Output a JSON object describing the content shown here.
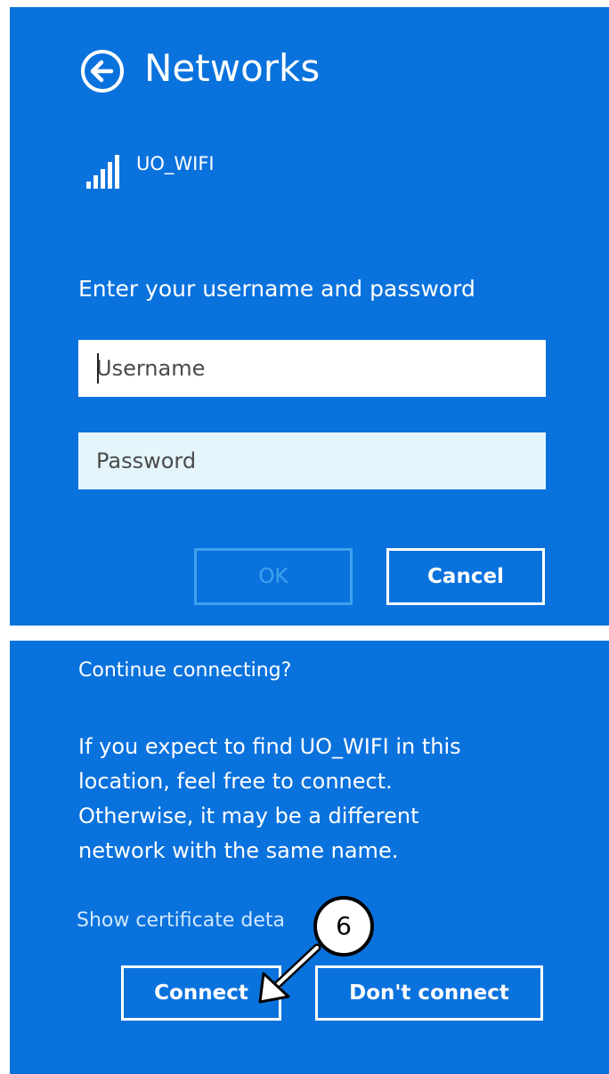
{
  "header": {
    "title": "Networks",
    "back_icon": "back-arrow-circle-icon"
  },
  "network": {
    "icon": "wifi-signal-icon",
    "name": "UO_WIFI"
  },
  "login_form": {
    "prompt": "Enter your username and password",
    "username_placeholder": "Username",
    "password_placeholder": "Password",
    "ok_label": "OK",
    "cancel_label": "Cancel"
  },
  "continue_dialog": {
    "question": "Continue connecting?",
    "description_lines": [
      "If you expect to find UO_WIFI in this",
      "location, feel free to connect.",
      "Otherwise, it may be a different",
      "network with the same name."
    ],
    "certificate_link": "Show certificate deta",
    "connect_label": "Connect",
    "dont_connect_label": "Don't connect"
  },
  "annotation": {
    "step_number": "6"
  },
  "colors": {
    "panel_blue": "#0a72dd",
    "password_field_bg": "#e4f6fb",
    "disabled_border": "#3fa0ec"
  }
}
